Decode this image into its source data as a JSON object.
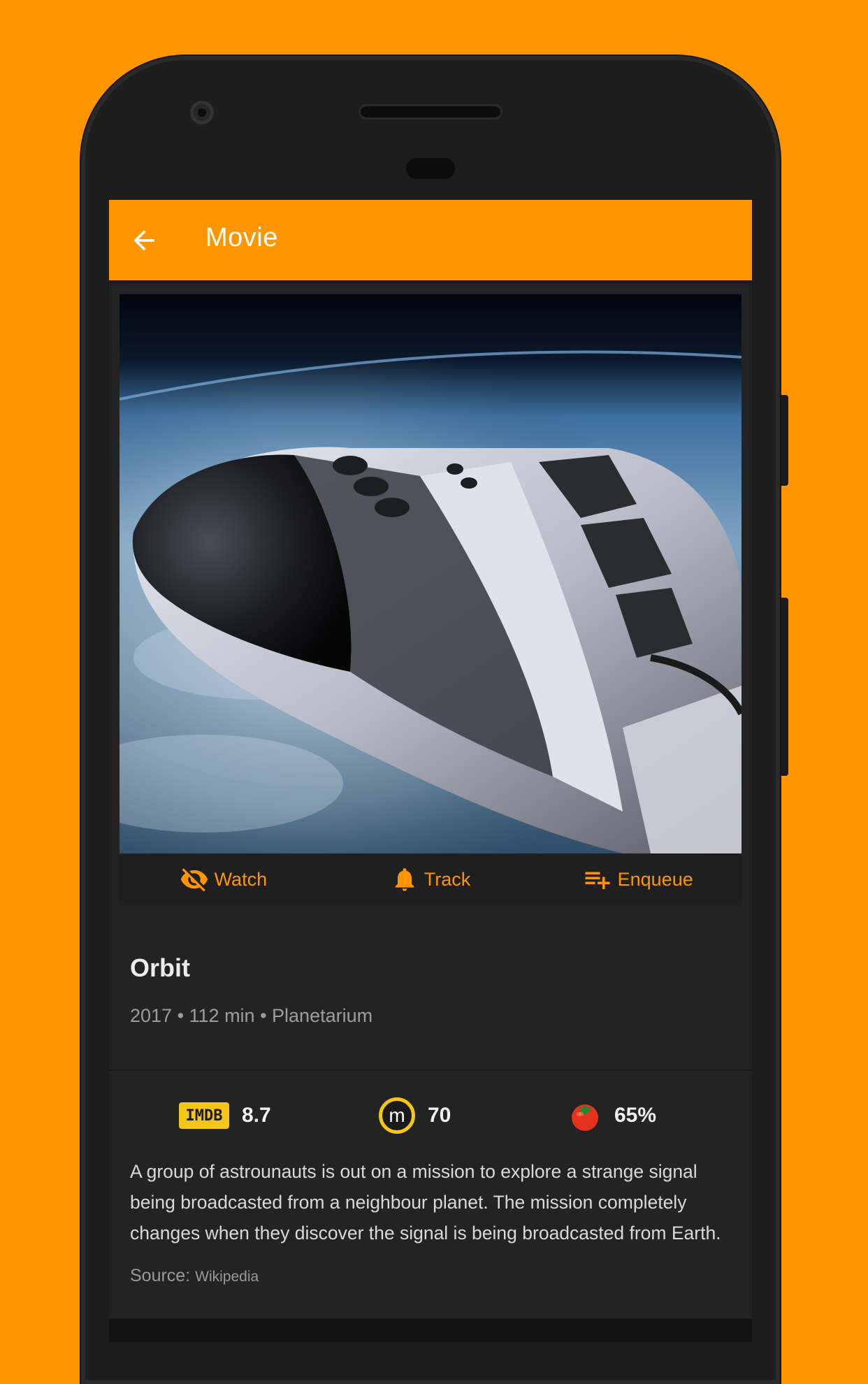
{
  "appbar": {
    "title": "Movie",
    "back_icon": "arrow-back-icon"
  },
  "actions": [
    {
      "label": "Watch",
      "icon": "eye-off-icon"
    },
    {
      "label": "Track",
      "icon": "bell-icon"
    },
    {
      "label": "Enqueue",
      "icon": "playlist-add-icon"
    }
  ],
  "movie": {
    "title": "Orbit",
    "meta": "2017 • 112 min • Planetarium",
    "synopsis": "A group of astrounauts is out on a mission to explore a strange signal being broadcasted from a neighbour planet. The mission completely changes when they discover the signal is being broadcasted from Earth.",
    "source_label": "Source:",
    "source_site": "Wikipedia"
  },
  "ratings": {
    "imdb_logo": "IMDB",
    "imdb": "8.7",
    "metacritic_logo": "m",
    "metacritic": "70",
    "rotten_tomatoes": "65%"
  },
  "colors": {
    "accent": "#ff9500",
    "background": "#232323",
    "imdb": "#f5c518"
  }
}
